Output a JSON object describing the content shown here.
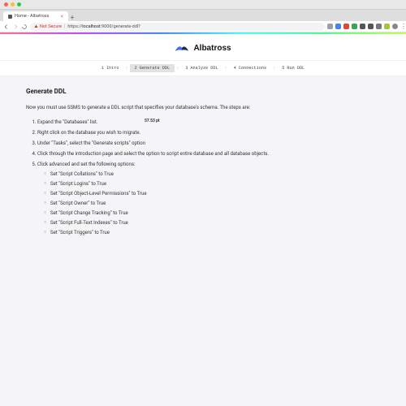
{
  "window": {
    "tab_title": "Home - Albatross"
  },
  "toolbar": {
    "not_secure": "Not Secure",
    "url_host": "localhost",
    "url_rest": ":9000/generate-ddl?"
  },
  "brand": {
    "name": "Albatross"
  },
  "wizard": {
    "steps": [
      {
        "num": "1",
        "label": "Intro"
      },
      {
        "num": "2",
        "label": "Generate DDL"
      },
      {
        "num": "3",
        "label": "Analyze DDL"
      },
      {
        "num": "4",
        "label": "Connections"
      },
      {
        "num": "5",
        "label": "Run DDL"
      }
    ]
  },
  "page": {
    "title": "Generate DDL",
    "intro": "Now you must use SSMS to generate a DDL script that specifies your database's schema. The steps are:",
    "badge": "57.53 pt",
    "ol": [
      "Expand the \"Databases\" list.",
      "Right click on the database you wish to migrate.",
      "Under \"Tasks\", select the \"Generate scripts\" option",
      "Click through the introduction page and select the option to script entire database and all database objects.",
      "Click advanced and set the following options:"
    ],
    "sub": [
      "Set \"Script Collations\" to True",
      "Set \"Script Logins\" to True",
      "Set \"Script Object-Level Permissions\" to True",
      "Set \"Script Owner\" to True",
      "Set \"Script Change Tracking\" to True",
      "Set \"Script Full-Text Indexes\" to True",
      "Set \"Script Triggers\" to True"
    ]
  }
}
